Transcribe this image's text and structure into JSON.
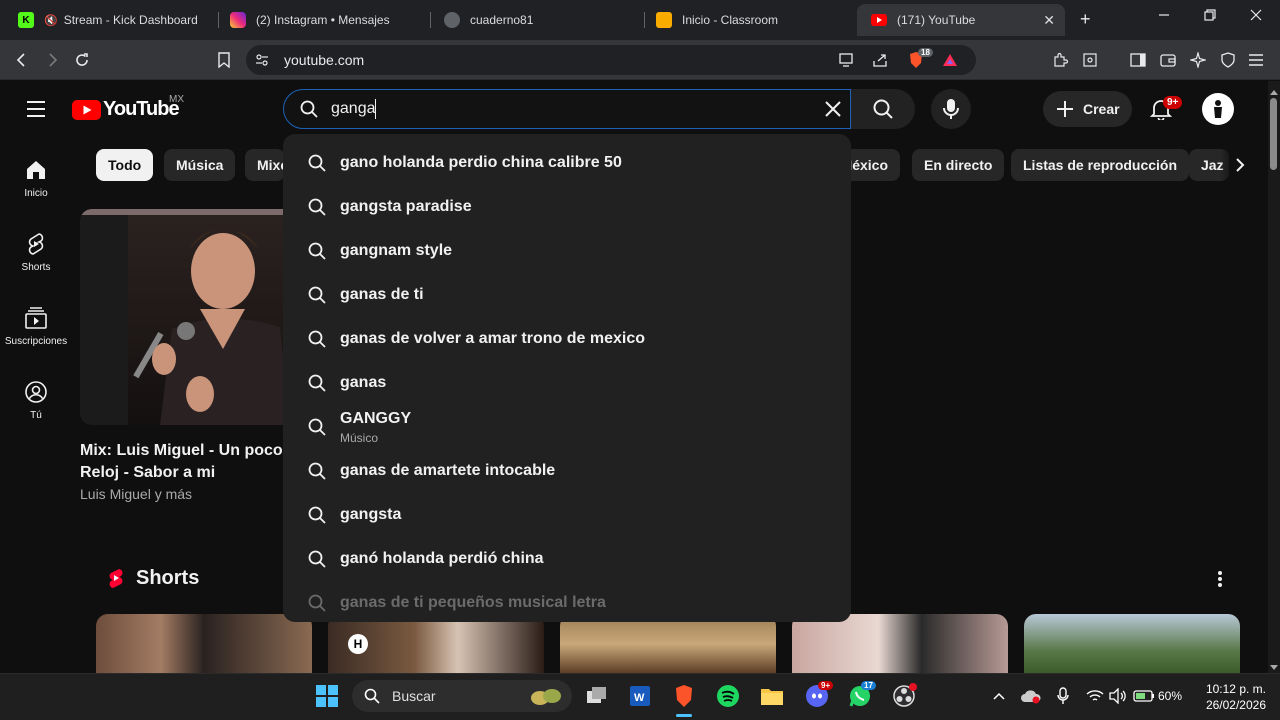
{
  "browser": {
    "tabs": [
      {
        "title": "Stream - Kick Dashboard",
        "active": false
      },
      {
        "title": "(2) Instagram • Mensajes",
        "active": false
      },
      {
        "title": "cuaderno81",
        "active": false
      },
      {
        "title": "Inicio - Classroom",
        "active": false
      },
      {
        "title": "(171) YouTube",
        "active": true
      }
    ],
    "new_tab": "+",
    "url": "youtube.com",
    "brave_badge": "18"
  },
  "youtube": {
    "logo_text": "YouTube",
    "region": "MX",
    "search": {
      "value": "ganga",
      "placeholder": "Buscar"
    },
    "create_label": "Crear",
    "notif_count": "9+",
    "sidebar": [
      {
        "label": "Inicio",
        "icon": "home-icon"
      },
      {
        "label": "Shorts",
        "icon": "shorts-icon"
      },
      {
        "label": "Suscripciones",
        "icon": "subscriptions-icon"
      },
      {
        "label": "Tú",
        "icon": "you-icon"
      }
    ],
    "chips": [
      "Todo",
      "Música",
      "Mixe",
      "México",
      "En directo",
      "Listas de reproducción",
      "Jaz"
    ],
    "suggestions": [
      {
        "text": "gano holanda perdio china calibre 50"
      },
      {
        "text": "gangsta paradise"
      },
      {
        "text": "gangnam style"
      },
      {
        "text": "ganas de ti"
      },
      {
        "text": "ganas de volver a amar trono de mexico"
      },
      {
        "text": "ganas"
      },
      {
        "text": "GANGGY",
        "sub": "Músico"
      },
      {
        "text": "ganas de amartete intocable"
      },
      {
        "text": "gangsta"
      },
      {
        "text": "ganó holanda perdió china"
      },
      {
        "text": "ganas de ti pequeños musical letra"
      }
    ],
    "video": {
      "title_line1": "Mix: Luis Miguel - Un poco m",
      "title_line2": "Reloj - Sabor a mi",
      "channel": "Luis Miguel y más"
    },
    "shorts_heading": "Shorts"
  },
  "taskbar": {
    "search_label": "Buscar",
    "discord_badge": "9+",
    "whatsapp_badge": "17",
    "battery": "60%",
    "time": "10:12 p. m.",
    "date": "26/02/2026"
  },
  "colors": {
    "yt_red": "#ff0000",
    "accent_blue": "#1c62b9",
    "bg": "#0f0f0f"
  }
}
